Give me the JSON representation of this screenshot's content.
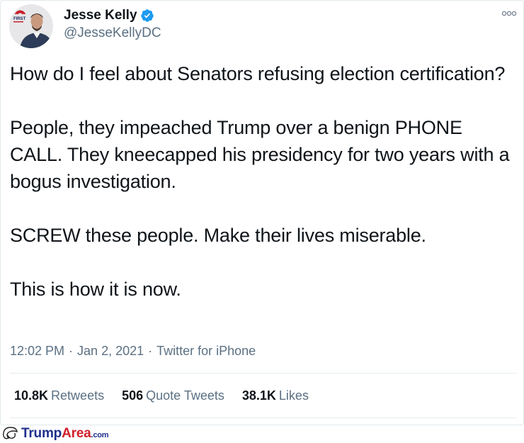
{
  "author": {
    "name": "Jesse Kelly",
    "handle": "@JesseKellyDC",
    "avatar_logo_text": "FIRST"
  },
  "tweet": {
    "paragraphs": [
      "How do I feel about Senators refusing election certification?",
      "People, they impeached Trump over a benign PHONE CALL. They kneecapped his presidency for two years with a bogus investigation.",
      "SCREW these people. Make their lives miserable.",
      "This is how it is now."
    ],
    "time": "12:02 PM",
    "date": "Jan 2, 2021",
    "source": "Twitter for iPhone",
    "dot": "·"
  },
  "stats": {
    "retweets_count": "10.8K",
    "retweets_label": "Retweets",
    "quotes_count": "506",
    "quotes_label": "Quote Tweets",
    "likes_count": "38.1K",
    "likes_label": "Likes"
  },
  "watermark": {
    "brand_a": "Trump",
    "brand_b": "Area",
    "domain": ".com"
  },
  "colors": {
    "verified": "#1d9bf0",
    "secondary_text": "#5b7083",
    "watermark_blue": "#1e2f8c",
    "watermark_red": "#d0202a"
  },
  "icons": {
    "verified": "verified-badge-icon",
    "more": "more-options-icon",
    "watermark": "trump-silhouette-icon"
  }
}
